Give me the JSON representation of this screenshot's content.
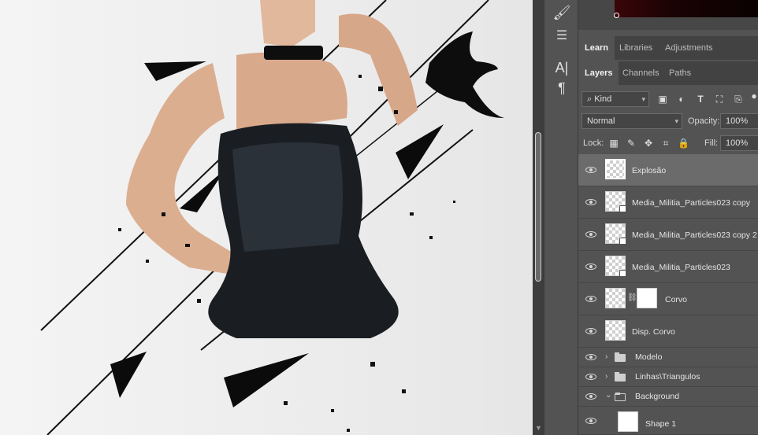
{
  "panel": {
    "tabs_top": [
      {
        "label": "Learn",
        "active": true
      },
      {
        "label": "Libraries",
        "active": false
      },
      {
        "label": "Adjustments",
        "active": false
      }
    ],
    "tabs_layers": [
      {
        "label": "Layers",
        "active": true
      },
      {
        "label": "Channels",
        "active": false
      },
      {
        "label": "Paths",
        "active": false
      }
    ],
    "filter": {
      "kind_label": "Kind"
    },
    "blend": {
      "mode": "Normal",
      "opacity_label": "Opacity:",
      "opacity_value": "100%"
    },
    "lock": {
      "label": "Lock:",
      "fill_label": "Fill:",
      "fill_value": "100%"
    },
    "layers": [
      {
        "name": "Explosão",
        "type": "pixel",
        "selected": true
      },
      {
        "name": "Media_Militia_Particles023 copy",
        "type": "smart"
      },
      {
        "name": "Media_Militia_Particles023 copy 2",
        "type": "smart"
      },
      {
        "name": "Media_Militia_Particles023",
        "type": "smart"
      },
      {
        "name": "Corvo",
        "type": "masked"
      },
      {
        "name": "Disp. Corvo",
        "type": "pixel"
      },
      {
        "name": "Modelo",
        "type": "group",
        "expanded": false
      },
      {
        "name": "Linhas\\Triangulos",
        "type": "group",
        "expanded": false
      },
      {
        "name": "Background",
        "type": "group",
        "expanded": true
      },
      {
        "name": "Shape 1",
        "type": "shape"
      }
    ]
  },
  "tools": [
    "brush-settings-icon",
    "adjust-sliders-icon",
    "character-icon",
    "paragraph-icon"
  ],
  "colors": {
    "accent": "#3d3d3d",
    "panel_bg": "#535353",
    "tab_bg": "#424242",
    "selected_row": "#6b6b6b"
  }
}
